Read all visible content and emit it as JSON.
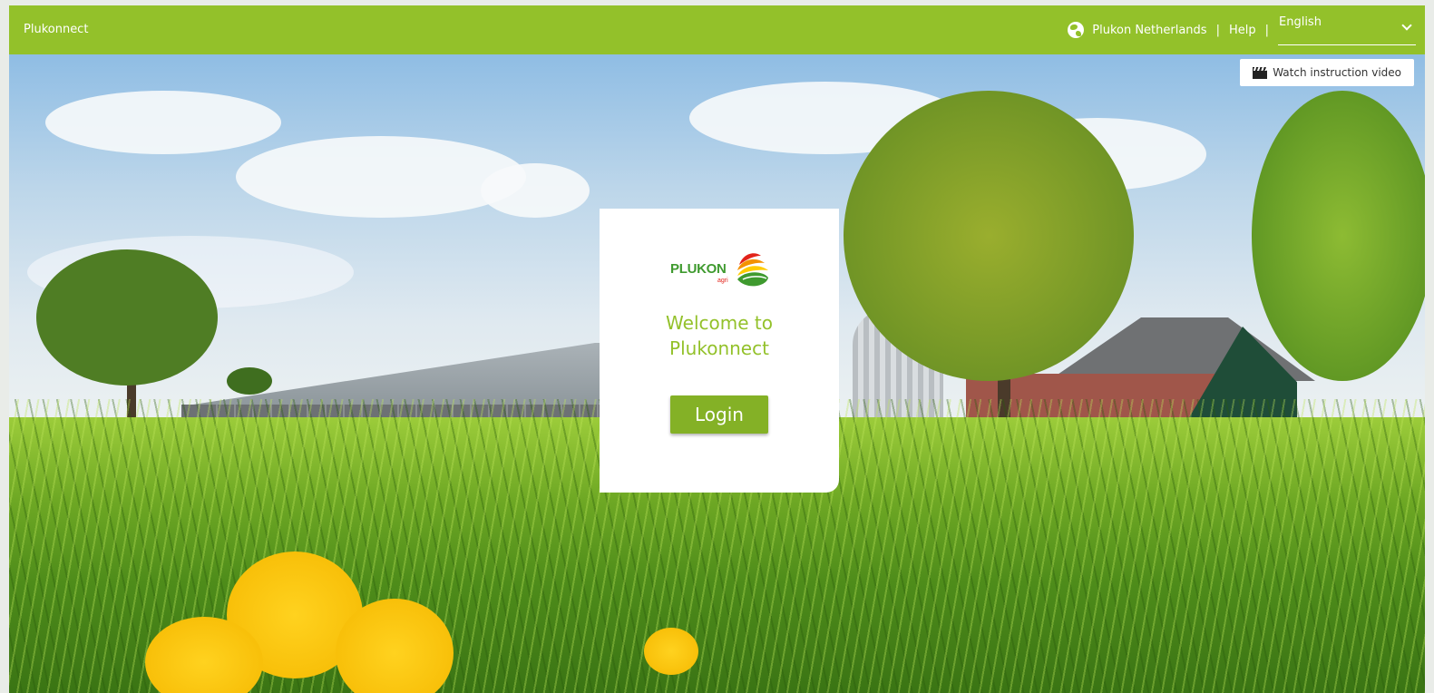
{
  "app": {
    "brand": "Plukonnect"
  },
  "topnav": {
    "region_icon": "globe-icon",
    "region": "Plukon Netherlands",
    "help": "Help",
    "separator": "|",
    "language": {
      "selected": "English"
    }
  },
  "video_button": {
    "label": "Watch instruction video",
    "icon": "clapperboard-icon"
  },
  "card": {
    "logo": {
      "text": "PLUKON",
      "sub": "agri"
    },
    "welcome_line1": "Welcome to",
    "welcome_line2": "Plukonnect",
    "login_label": "Login"
  },
  "colors": {
    "brand_green": "#93c12a",
    "button_green": "#84b126",
    "logo_green": "#3f9a2f"
  }
}
